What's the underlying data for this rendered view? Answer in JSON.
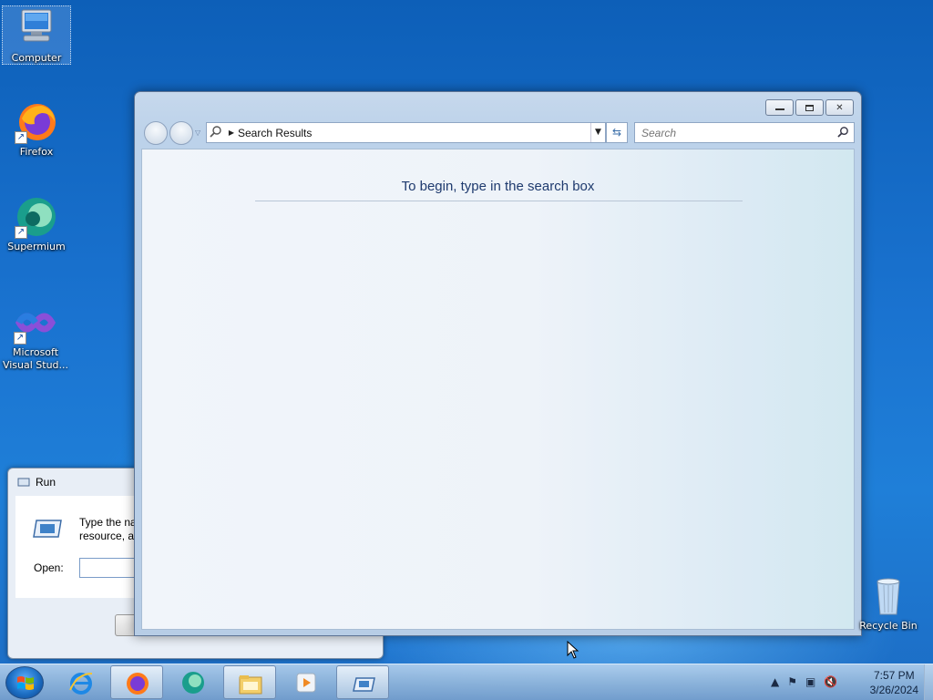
{
  "desktop": {
    "icons": [
      {
        "label": "Computer"
      },
      {
        "label": "Firefox"
      },
      {
        "label": "Supermium"
      },
      {
        "label": "Microsoft Visual Stud..."
      },
      {
        "label": "Recycle Bin"
      }
    ]
  },
  "run_dialog": {
    "title": "Run",
    "description_line1": "Type the nan",
    "description_line2": "resource, anc",
    "open_label": "Open:",
    "open_value": ""
  },
  "search_window": {
    "address_text": "Search Results",
    "search_placeholder": "Search",
    "empty_message": "To begin, type in the search box",
    "controls": {
      "minimize": "—",
      "restore": "❐",
      "close": "✕"
    }
  },
  "taskbar": {
    "clock_time": "7:57 PM",
    "clock_date": "3/26/2024",
    "pinned": [
      "internet-explorer",
      "firefox",
      "supermium",
      "file-explorer",
      "media-player",
      "run"
    ]
  }
}
